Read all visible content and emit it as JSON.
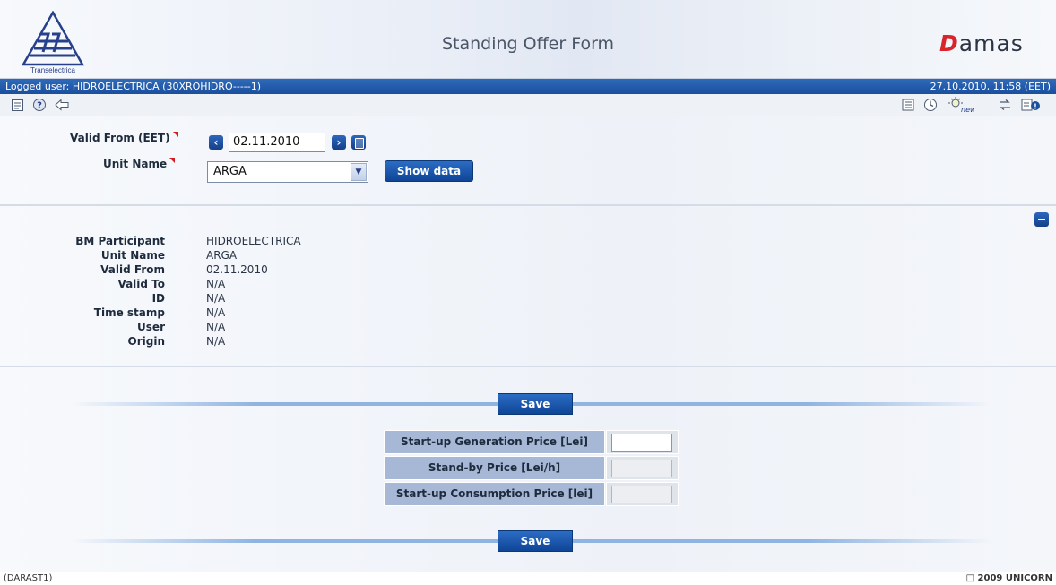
{
  "header": {
    "title": "Standing Offer Form",
    "logo_left_caption": "Transelectrica",
    "logo_right_text": "amas",
    "logo_right_initial": "D"
  },
  "status": {
    "logged_user": "Logged user: HIDROELECTRICA (30XROHIDRO-----1)",
    "datetime": "27.10.2010, 11:58  (EET)"
  },
  "toolbar": {
    "left_icons": [
      "document-icon",
      "help-icon",
      "back-arrow-icon"
    ],
    "right_icons": [
      "list-icon",
      "clock-icon",
      "new-bulb-icon",
      "transfer-icon",
      "info-document-icon"
    ]
  },
  "filter": {
    "valid_from_label": "Valid From (EET)",
    "valid_from_value": "02.11.2010",
    "unit_name_label": "Unit Name",
    "unit_name_selected": "ARGA",
    "show_data_label": "Show data"
  },
  "details": {
    "rows": [
      {
        "label": "BM Participant",
        "value": "HIDROELECTRICA"
      },
      {
        "label": "Unit Name",
        "value": "ARGA"
      },
      {
        "label": "Valid From",
        "value": "02.11.2010"
      },
      {
        "label": "Valid To",
        "value": "N/A"
      },
      {
        "label": "ID",
        "value": "N/A"
      },
      {
        "label": "Time stamp",
        "value": "N/A"
      },
      {
        "label": "User",
        "value": "N/A"
      },
      {
        "label": "Origin",
        "value": "N/A"
      }
    ]
  },
  "offer": {
    "save_label": "Save",
    "prices": [
      {
        "label": "Start-up Generation Price [Lei]",
        "value": "",
        "enabled": true
      },
      {
        "label": "Stand-by Price [Lei/h]",
        "value": "",
        "enabled": false
      },
      {
        "label": "Start-up Consumption Price [lei]",
        "value": "",
        "enabled": false
      }
    ]
  },
  "footer": {
    "left": "(DARAST1)",
    "right": "□ 2009 UNICORN"
  },
  "colors": {
    "accent_blue": "#1a4f9e",
    "required_red": "#d01c1c",
    "table_header": "#a6b8d6"
  }
}
